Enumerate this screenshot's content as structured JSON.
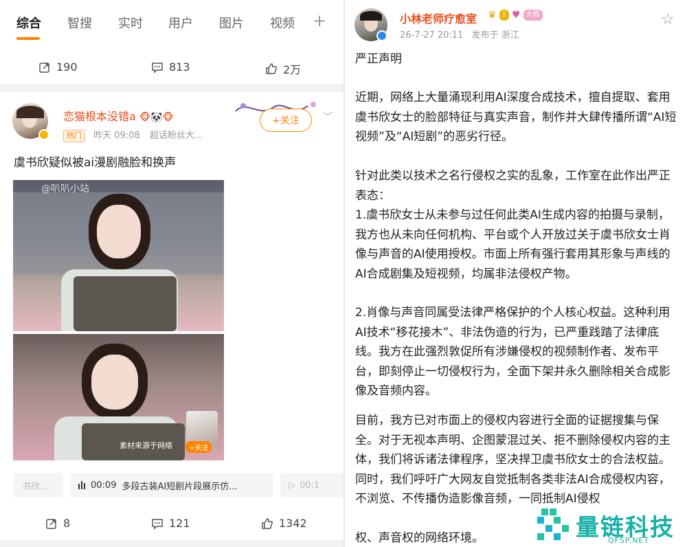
{
  "left": {
    "tabs": [
      "综合",
      "智搜",
      "实时",
      "用户",
      "图片",
      "视频"
    ],
    "tab_plus": "+",
    "prev_post_actions": {
      "repost": "190",
      "comment": "813",
      "like": "2万"
    },
    "post": {
      "username": "恋猫根本没错a",
      "name_emojis": "🐵🐼🐵",
      "hot_tag": "热门",
      "time": "昨天 09:08",
      "source": "超话粉丝大...",
      "follow_label": "+关注",
      "chevron": "﹀",
      "text": "虞书欣疑似被ai漫剧融脸和换声",
      "image_watermark": "@叭叭小站",
      "image_caption": "素材来源于网络",
      "image_follow": "+关注",
      "video_chips": [
        {
          "label": "书欣..."
        },
        {
          "icon": "audio-bars-icon",
          "duration": "00:09",
          "title": "多段古装AI短剧片段展示仿..."
        },
        {
          "icon": "play-icon",
          "duration": "00:1"
        }
      ],
      "actions": {
        "repost": "8",
        "comment": "121",
        "like": "1342"
      }
    }
  },
  "right": {
    "username": "小林老师疗愈室",
    "badges": [
      "1",
      "大殿"
    ],
    "time": "26-7-27 20:11",
    "location": "发布于 浙江",
    "paragraphs": [
      "严正声明",
      "近期，网络上大量涌现利用AI深度合成技术，擅自提取、套用虞书欣女士的脸部特征与真实声音，制作并大肆传播所谓“AI短视频”及“AI短剧”的恶劣行径。",
      "针对此类以技术之名行侵权之实的乱象，工作室在此作出严正表态：",
      "1.虞书欣女士从未参与过任何此类AI生成内容的拍摄与录制，我方也从未向任何机构、平台或个人开放过关于虞书欣女士肖像与声音的AI使用授权。市面上所有强行套用其形象与声线的AI合成剧集及短视频，均属非法侵权产物。",
      "2.肖像与声音同属受法律严格保护的个人核心权益。这种利用AI技术“移花接木”、非法伪造的行为，已严重践踏了法律底线。我方在此强烈敦促所有涉嫌侵权的视频制作者、发布平台，即刻停止一切侵权行为，全面下架并永久删除相关合成影像及音频内容。",
      "目前，我方已对市面上的侵权内容进行全面的证据搜集与保全。对于无视本声明、企图蒙混过关、拒不删除侵权内容的主体，我们将诉诸法律程序，坚决捍卫虞书欣女士的合法权益。同时，我们呼吁广大网友自觉抵制各类非法AI合成侵权内容，不浏览、不传播伪造影像音频，一同抵制AI侵权",
      "权、声音权的网络环境。"
    ]
  },
  "watermark": {
    "brand": "量链科技",
    "url": "QFSP.NET"
  },
  "colors": {
    "accent": "#ff8200",
    "username": "#ea4d1d",
    "brand": "#17b0a6"
  }
}
